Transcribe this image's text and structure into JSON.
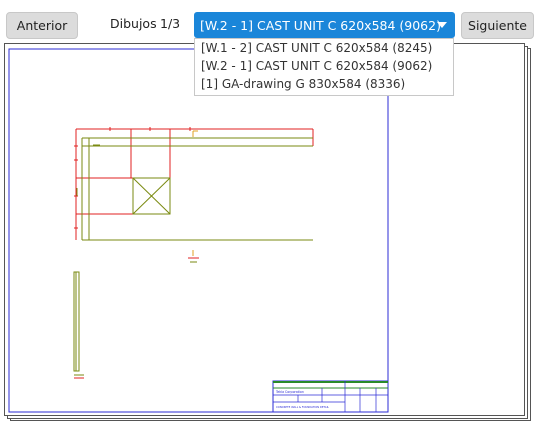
{
  "toolbar": {
    "prev_label": "Anterior",
    "next_label": "Siguiente",
    "drawings_label": "Dibujos",
    "drawing_count": "1/3"
  },
  "drawing_select": {
    "selected": "[W.2 - 1] CAST UNIT C 620x584 (9062)",
    "options": [
      "[W.1 - 2] CAST UNIT C 620x584 (8245)",
      "[W.2 - 1] CAST UNIT C 620x584 (9062)",
      "[1] GA-drawing G 830x584 (8336)"
    ]
  },
  "title_block": {
    "company": "Tekla Corporation",
    "title": "CONCRETE WALL & FOUNDATION DETAIL"
  },
  "colors": {
    "accent": "#1a86d9",
    "frame_blue": "#2b2bd6",
    "dim_red": "#e02020",
    "outline_olive": "#7a8a10"
  }
}
